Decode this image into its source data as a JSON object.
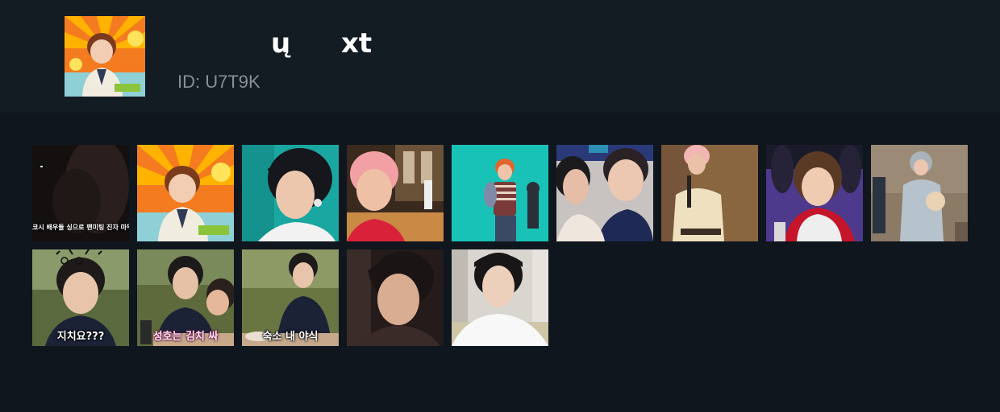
{
  "profile": {
    "name_part_1": "ų",
    "name_part_2": "xt",
    "id_text": "ID: U7T9K"
  },
  "tiles": [
    {
      "theme": "dark-video",
      "caption": "코시 배우들 싱으로 팬미팅 진자 마무"
    },
    {
      "theme": "orange-sunburst",
      "caption": ""
    },
    {
      "theme": "teal-earbud",
      "caption": ""
    },
    {
      "theme": "pink-hair-gym",
      "caption": ""
    },
    {
      "theme": "teal-dance",
      "caption": ""
    },
    {
      "theme": "group-selfie",
      "caption": ""
    },
    {
      "theme": "warm-beige",
      "caption": ""
    },
    {
      "theme": "purple-stage",
      "caption": ""
    },
    {
      "theme": "grey-hoodie",
      "caption": ""
    },
    {
      "theme": "forest-cat",
      "caption": "지치요???"
    },
    {
      "theme": "forest-eating",
      "caption": "성호는 김치 싸"
    },
    {
      "theme": "forest-sitting",
      "caption": "숙소 내 야식"
    },
    {
      "theme": "dark-closeup",
      "caption": ""
    },
    {
      "theme": "bright-room",
      "caption": ""
    }
  ],
  "colors": {
    "page_bg": "#0f161d",
    "header_bg": "#131b23",
    "id_text": "#8a8f95"
  }
}
